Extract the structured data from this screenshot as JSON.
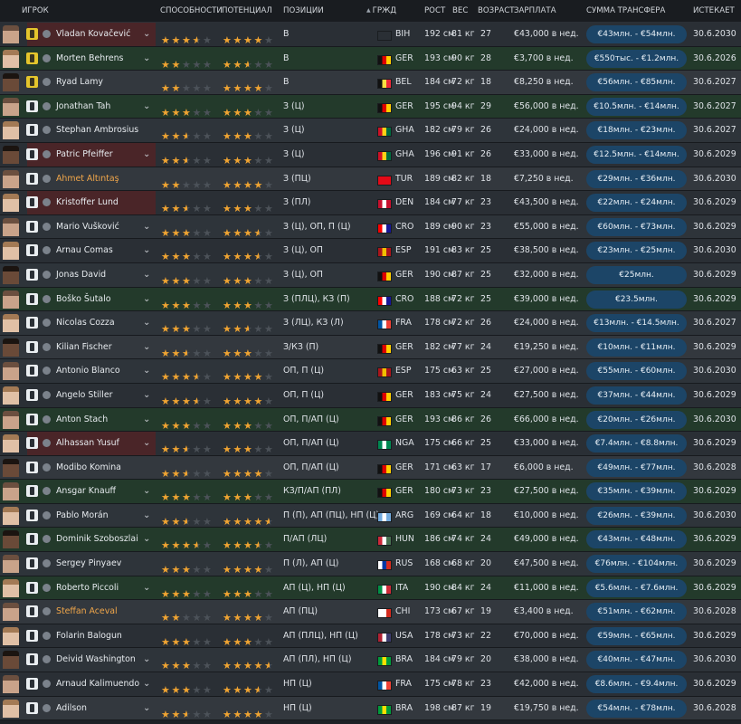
{
  "header": {
    "player": "ИГРОК",
    "ability": "СПОСОБНОСТИ",
    "potential": "ПОТЕНЦИАЛ",
    "positions": "ПОЗИЦИИ",
    "nationality": "ГРЖД",
    "height": "РОСТ",
    "weight": "ВЕС",
    "age": "ВОЗРАСТ",
    "wage": "ЗАРПЛАТА",
    "transfer": "СУММА ТРАНСФЕРА",
    "expires": "ИСТЕКАЕТ"
  },
  "colors": {
    "accent_star": "#f0a432",
    "value_pill": "#1c4567",
    "name_highlight": "#f0a64a"
  },
  "players": [
    {
      "name": "Vladan Kovačević",
      "ca": 3.5,
      "pa": 4,
      "pos": "В",
      "nat": "BIH",
      "h": "192 см",
      "w": "81 кг",
      "age": "27",
      "wage": "€43,000 в нед.",
      "value": "€43млн. - €54млн.",
      "exp": "30.6.2030",
      "kit": "gk",
      "chev": true,
      "tone": "red",
      "flag": [
        "#1f3f8f",
        "#f2c21b"
      ]
    },
    {
      "name": "Morten Behrens",
      "ca": 2,
      "pa": 2.5,
      "pos": "В",
      "nat": "GER",
      "h": "193 см",
      "w": "90 кг",
      "age": "28",
      "wage": "€3,700 в нед.",
      "value": "€550тыс. - €1.2млн.",
      "exp": "30.6.2026",
      "kit": "gk",
      "chev": true,
      "tone": "green",
      "flag": [
        "#111111",
        "#dd0000",
        "#ffce00"
      ]
    },
    {
      "name": "Ryad Lamy",
      "ca": 2,
      "pa": 4,
      "pos": "В",
      "nat": "BEL",
      "h": "184 см",
      "w": "72 кг",
      "age": "18",
      "wage": "€8,250 в нед.",
      "value": "€56млн. - €85млн.",
      "exp": "30.6.2027",
      "kit": "gk",
      "chev": false,
      "tone": "dark",
      "flag": [
        "#111111",
        "#fae042",
        "#ed2939"
      ]
    },
    {
      "name": "Jonathan Tah",
      "ca": 3,
      "pa": 3,
      "pos": "З (Ц)",
      "nat": "GER",
      "h": "195 см",
      "w": "94 кг",
      "age": "29",
      "wage": "€56,000 в нед.",
      "value": "€10.5млн. - €14млн.",
      "exp": "30.6.2027",
      "kit": "out",
      "chev": true,
      "tone": "green",
      "flag": [
        "#111111",
        "#dd0000",
        "#ffce00"
      ]
    },
    {
      "name": "Stephan Ambrosius",
      "ca": 2.5,
      "pa": 3,
      "pos": "З (Ц)",
      "nat": "GHA",
      "h": "182 см",
      "w": "79 кг",
      "age": "26",
      "wage": "€24,000 в нед.",
      "value": "€18млн. - €23млн.",
      "exp": "30.6.2027",
      "kit": "out",
      "chev": false,
      "tone": "",
      "flag": [
        "#ce1126",
        "#fcd116",
        "#006b3f"
      ]
    },
    {
      "name": "Patric Pfeiffer",
      "ca": 2.5,
      "pa": 3,
      "pos": "З (Ц)",
      "nat": "GHA",
      "h": "196 см",
      "w": "91 кг",
      "age": "26",
      "wage": "€33,000 в нед.",
      "value": "€12.5млн. - €14млн.",
      "exp": "30.6.2029",
      "kit": "out",
      "chev": true,
      "tone": "red",
      "flag": [
        "#ce1126",
        "#fcd116",
        "#006b3f"
      ]
    },
    {
      "name": "Ahmet Altıntaş",
      "ca": 2,
      "pa": 4,
      "pos": "З (ПЦ)",
      "nat": "TUR",
      "h": "189 см",
      "w": "82 кг",
      "age": "18",
      "wage": "€7,250 в нед.",
      "value": "€29млн. - €36млн.",
      "exp": "30.6.2030",
      "kit": "out",
      "chev": false,
      "tone": "dark",
      "orange": true,
      "flag": [
        "#e30a17",
        "#e30a17",
        "#e30a17"
      ]
    },
    {
      "name": "Kristoffer Lund",
      "ca": 2.5,
      "pa": 3,
      "pos": "З (ПЛ)",
      "nat": "DEN",
      "h": "184 см",
      "w": "77 кг",
      "age": "23",
      "wage": "€43,500 в нед.",
      "value": "€22млн. - €24млн.",
      "exp": "30.6.2029",
      "kit": "out",
      "chev": false,
      "tone": "red",
      "flag": [
        "#c8102e",
        "#ffffff",
        "#c8102e"
      ]
    },
    {
      "name": "Mario Vušković",
      "ca": 3,
      "pa": 3.5,
      "pos": "З (Ц), ОП, П (Ц)",
      "nat": "CRO",
      "h": "189 см",
      "w": "90 кг",
      "age": "23",
      "wage": "€55,000 в нед.",
      "value": "€60млн. - €73млн.",
      "exp": "30.6.2029",
      "kit": "out",
      "chev": true,
      "tone": "",
      "flag": [
        "#ff0000",
        "#ffffff",
        "#171796"
      ]
    },
    {
      "name": "Arnau Comas",
      "ca": 3,
      "pa": 3.5,
      "pos": "З (Ц), ОП",
      "nat": "ESP",
      "h": "191 см",
      "w": "83 кг",
      "age": "25",
      "wage": "€38,500 в нед.",
      "value": "€23млн. - €25млн.",
      "exp": "30.6.2030",
      "kit": "out",
      "chev": true,
      "tone": "",
      "flag": [
        "#aa151b",
        "#f1bf00",
        "#aa151b"
      ]
    },
    {
      "name": "Jonas David",
      "ca": 3,
      "pa": 3,
      "pos": "З (Ц), ОП",
      "nat": "GER",
      "h": "190 см",
      "w": "87 кг",
      "age": "25",
      "wage": "€32,000 в нед.",
      "value": "€25млн.",
      "exp": "30.6.2029",
      "kit": "out",
      "chev": true,
      "tone": "",
      "flag": [
        "#111111",
        "#dd0000",
        "#ffce00"
      ]
    },
    {
      "name": "Boško Šutalo",
      "ca": 3,
      "pa": 3,
      "pos": "З (ПЛЦ), КЗ (П)",
      "nat": "CRO",
      "h": "188 см",
      "w": "72 кг",
      "age": "25",
      "wage": "€39,000 в нед.",
      "value": "€23.5млн.",
      "exp": "30.6.2029",
      "kit": "out",
      "chev": true,
      "tone": "green",
      "flag": [
        "#ff0000",
        "#ffffff",
        "#171796"
      ]
    },
    {
      "name": "Nicolas Cozza",
      "ca": 3,
      "pa": 2.5,
      "pos": "З (ЛЦ), КЗ (Л)",
      "nat": "FRA",
      "h": "178 см",
      "w": "72 кг",
      "age": "26",
      "wage": "€24,000 в нед.",
      "value": "€13млн. - €14.5млн.",
      "exp": "30.6.2027",
      "kit": "out",
      "chev": true,
      "tone": "",
      "flag": [
        "#0055a4",
        "#ffffff",
        "#ef4135"
      ]
    },
    {
      "name": "Kilian Fischer",
      "ca": 2.5,
      "pa": 3,
      "pos": "З/КЗ (П)",
      "nat": "GER",
      "h": "182 см",
      "w": "77 кг",
      "age": "24",
      "wage": "€19,250 в нед.",
      "value": "€10млн. - €11млн.",
      "exp": "30.6.2029",
      "kit": "out",
      "chev": true,
      "tone": "dark",
      "flag": [
        "#111111",
        "#dd0000",
        "#ffce00"
      ]
    },
    {
      "name": "Antonio Blanco",
      "ca": 3.5,
      "pa": 4,
      "pos": "ОП, П (Ц)",
      "nat": "ESP",
      "h": "175 см",
      "w": "63 кг",
      "age": "25",
      "wage": "€27,000 в нед.",
      "value": "€55млн. - €60млн.",
      "exp": "30.6.2030",
      "kit": "out",
      "chev": true,
      "tone": "",
      "flag": [
        "#aa151b",
        "#f1bf00",
        "#aa151b"
      ]
    },
    {
      "name": "Angelo Stiller",
      "ca": 3.5,
      "pa": 4,
      "pos": "ОП, П (Ц)",
      "nat": "GER",
      "h": "183 см",
      "w": "75 кг",
      "age": "24",
      "wage": "€27,500 в нед.",
      "value": "€37млн. - €44млн.",
      "exp": "30.6.2029",
      "kit": "out",
      "chev": true,
      "tone": "",
      "flag": [
        "#111111",
        "#dd0000",
        "#ffce00"
      ]
    },
    {
      "name": "Anton Stach",
      "ca": 3,
      "pa": 3,
      "pos": "ОП, П/АП (Ц)",
      "nat": "GER",
      "h": "193 см",
      "w": "86 кг",
      "age": "26",
      "wage": "€66,000 в нед.",
      "value": "€20млн. - €26млн.",
      "exp": "30.6.2030",
      "kit": "out",
      "chev": true,
      "tone": "green",
      "flag": [
        "#111111",
        "#dd0000",
        "#ffce00"
      ]
    },
    {
      "name": "Alhassan Yusuf",
      "ca": 2.5,
      "pa": 3,
      "pos": "ОП, П/АП (Ц)",
      "nat": "NGA",
      "h": "175 см",
      "w": "66 кг",
      "age": "25",
      "wage": "€33,000 в нед.",
      "value": "€7.4млн. - €8.8млн.",
      "exp": "30.6.2029",
      "kit": "out",
      "chev": true,
      "tone": "red",
      "flag": [
        "#008751",
        "#ffffff",
        "#008751"
      ]
    },
    {
      "name": "Modibo Komina",
      "ca": 2.5,
      "pa": 4,
      "pos": "ОП, П/АП (Ц)",
      "nat": "GER",
      "h": "171 см",
      "w": "63 кг",
      "age": "17",
      "wage": "€6,000 в нед.",
      "value": "€49млн. - €77млн.",
      "exp": "30.6.2028",
      "kit": "out",
      "chev": false,
      "tone": "dark",
      "flag": [
        "#111111",
        "#dd0000",
        "#ffce00"
      ]
    },
    {
      "name": "Ansgar Knauff",
      "ca": 3,
      "pa": 3,
      "pos": "КЗ/П/АП (ПЛ)",
      "nat": "GER",
      "h": "180 см",
      "w": "73 кг",
      "age": "23",
      "wage": "€27,500 в нед.",
      "value": "€35млн. - €39млн.",
      "exp": "30.6.2029",
      "kit": "out",
      "chev": true,
      "tone": "green",
      "flag": [
        "#111111",
        "#dd0000",
        "#ffce00"
      ]
    },
    {
      "name": "Pablo Morán",
      "ca": 2.5,
      "pa": 4.5,
      "pos": "П (П), АП (ПЦ), НП (Ц)",
      "nat": "ARG",
      "h": "169 см",
      "w": "64 кг",
      "age": "18",
      "wage": "€10,000 в нед.",
      "value": "€26млн. - €39млн.",
      "exp": "30.6.2030",
      "kit": "out",
      "chev": true,
      "tone": "",
      "flag": [
        "#74acdf",
        "#ffffff",
        "#74acdf"
      ]
    },
    {
      "name": "Dominik Szoboszlai",
      "ca": 3.5,
      "pa": 3.5,
      "pos": "П/АП (ЛЦ)",
      "nat": "HUN",
      "h": "186 см",
      "w": "74 кг",
      "age": "24",
      "wage": "€49,000 в нед.",
      "value": "€43млн. - €48млн.",
      "exp": "30.6.2029",
      "kit": "out",
      "chev": true,
      "tone": "green",
      "flag": [
        "#ce2939",
        "#ffffff",
        "#477050"
      ]
    },
    {
      "name": "Sergey Pinyaev",
      "ca": 3,
      "pa": 4,
      "pos": "П (Л), АП (Ц)",
      "nat": "RUS",
      "h": "168 см",
      "w": "68 кг",
      "age": "20",
      "wage": "€47,500 в нед.",
      "value": "€76млн. - €104млн.",
      "exp": "30.6.2029",
      "kit": "out",
      "chev": false,
      "tone": "",
      "flag": [
        "#ffffff",
        "#0039a6",
        "#d52b1e"
      ]
    },
    {
      "name": "Roberto Piccoli",
      "ca": 3,
      "pa": 3,
      "pos": "АП (Ц), НП (Ц)",
      "nat": "ITA",
      "h": "190 см",
      "w": "84 кг",
      "age": "24",
      "wage": "€11,000 в нед.",
      "value": "€5.6млн. - €7.6млн.",
      "exp": "30.6.2029",
      "kit": "out",
      "chev": true,
      "tone": "green",
      "flag": [
        "#009246",
        "#ffffff",
        "#ce2b37"
      ]
    },
    {
      "name": "Steffan Aceval",
      "ca": 2,
      "pa": 4,
      "pos": "АП (ПЦ)",
      "nat": "CHI",
      "h": "173 см",
      "w": "67 кг",
      "age": "19",
      "wage": "€3,400 в нед.",
      "value": "€51млн. - €62млн.",
      "exp": "30.6.2028",
      "kit": "out",
      "chev": false,
      "tone": "dark",
      "orange": true,
      "flag": [
        "#ffffff",
        "#ffffff",
        "#d52b1e"
      ]
    },
    {
      "name": "Folarin Balogun",
      "ca": 3,
      "pa": 3,
      "pos": "АП (ПЛЦ), НП (Ц)",
      "nat": "USA",
      "h": "178 см",
      "w": "73 кг",
      "age": "22",
      "wage": "€70,000 в нед.",
      "value": "€59млн. - €65млн.",
      "exp": "30.6.2029",
      "kit": "out",
      "chev": false,
      "tone": "",
      "flag": [
        "#b22234",
        "#ffffff",
        "#3c3b6e"
      ]
    },
    {
      "name": "Deivid Washington",
      "ca": 3,
      "pa": 4.5,
      "pos": "АП (ПЛ), НП (Ц)",
      "nat": "BRA",
      "h": "184 см",
      "w": "79 кг",
      "age": "20",
      "wage": "€38,000 в нед.",
      "value": "€40млн. - €47млн.",
      "exp": "30.6.2030",
      "kit": "out",
      "chev": true,
      "tone": "",
      "flag": [
        "#009c3b",
        "#ffdf00",
        "#009c3b"
      ]
    },
    {
      "name": "Arnaud Kalimuendo",
      "ca": 3,
      "pa": 3.5,
      "pos": "НП (Ц)",
      "nat": "FRA",
      "h": "175 см",
      "w": "78 кг",
      "age": "23",
      "wage": "€42,000 в нед.",
      "value": "€8.6млн. - €9.4млн.",
      "exp": "30.6.2029",
      "kit": "out",
      "chev": true,
      "tone": "",
      "flag": [
        "#0055a4",
        "#ffffff",
        "#ef4135"
      ]
    },
    {
      "name": "Adilson",
      "ca": 2.5,
      "pa": 4,
      "pos": "НП (Ц)",
      "nat": "BRA",
      "h": "198 см",
      "w": "87 кг",
      "age": "19",
      "wage": "€19,750 в нед.",
      "value": "€54млн. - €78млн.",
      "exp": "30.6.2028",
      "kit": "out",
      "chev": true,
      "tone": "dark",
      "flag": [
        "#009c3b",
        "#ffdf00",
        "#009c3b"
      ]
    }
  ]
}
